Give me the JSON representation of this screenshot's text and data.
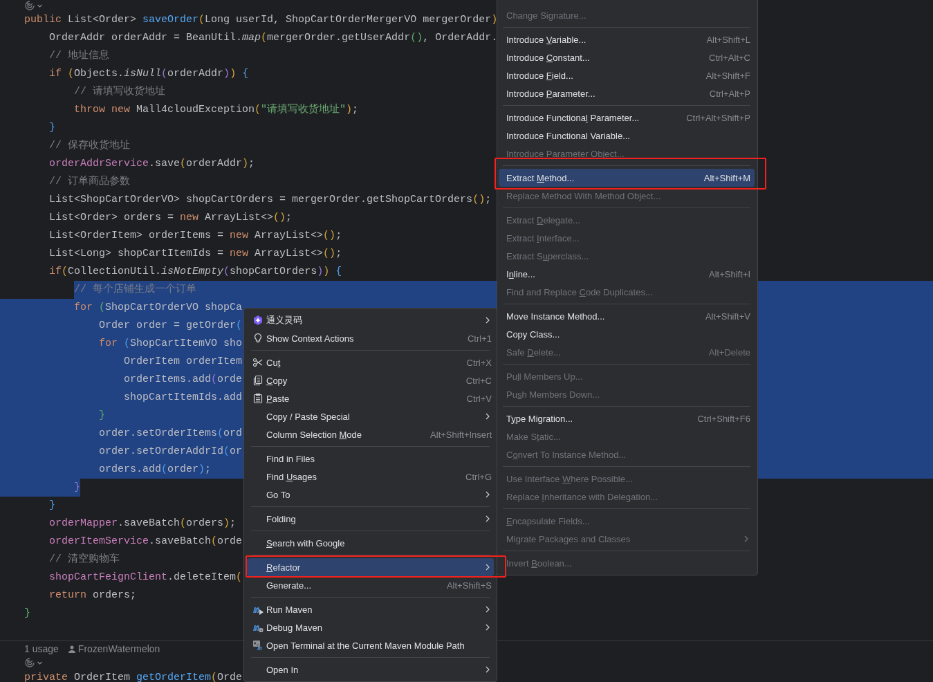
{
  "editor": {
    "lines": [
      {
        "tokens": [
          {
            "kind": "kw",
            "text": "public "
          },
          {
            "kind": "plain",
            "text": "List<Order> "
          },
          {
            "kind": "decl",
            "text": "saveOrder"
          },
          {
            "kind": "bracket_gold",
            "text": "("
          },
          {
            "kind": "plain",
            "text": "Long userId, ShopCartOrderMergerVO mergerOrder"
          },
          {
            "kind": "bracket_gold",
            "text": ")"
          }
        ]
      },
      {
        "tokens": [
          {
            "kind": "plain",
            "text": "    OrderAddr orderAddr = BeanUtil."
          },
          {
            "kind": "static",
            "text": "map"
          },
          {
            "kind": "bracket_gold",
            "text": "("
          },
          {
            "kind": "plain",
            "text": "mergerOrder.getUserAddr"
          },
          {
            "kind": "bracket_green",
            "text": "()"
          },
          {
            "kind": "plain",
            "text": ", OrderAddr."
          }
        ]
      },
      {
        "tokens": [
          {
            "kind": "comment",
            "text": "    // 地址信息"
          }
        ]
      },
      {
        "tokens": [
          {
            "kind": "kw",
            "text": "    if "
          },
          {
            "kind": "bracket_gold",
            "text": "("
          },
          {
            "kind": "plain",
            "text": "Objects."
          },
          {
            "kind": "static",
            "text": "isNull"
          },
          {
            "kind": "bracket_purple",
            "text": "("
          },
          {
            "kind": "plain",
            "text": "orderAddr"
          },
          {
            "kind": "bracket_purple",
            "text": ")"
          },
          {
            "kind": "bracket_gold",
            "text": ")"
          },
          {
            "kind": "bracket_blue",
            "text": " {"
          }
        ]
      },
      {
        "tokens": [
          {
            "kind": "comment",
            "text": "        // 请填写收货地址"
          }
        ]
      },
      {
        "tokens": [
          {
            "kind": "kw",
            "text": "        throw new "
          },
          {
            "kind": "plain",
            "text": "Mall4cloudException"
          },
          {
            "kind": "bracket_gold",
            "text": "("
          },
          {
            "kind": "string",
            "text": "\"请填写收货地址\""
          },
          {
            "kind": "bracket_gold",
            "text": ")"
          },
          {
            "kind": "plain",
            "text": ";"
          }
        ]
      },
      {
        "tokens": [
          {
            "kind": "bracket_blue",
            "text": "    }"
          }
        ]
      },
      {
        "tokens": [
          {
            "kind": "comment",
            "text": "    // 保存收货地址"
          }
        ]
      },
      {
        "tokens": [
          {
            "kind": "field",
            "text": "    orderAddrService"
          },
          {
            "kind": "plain",
            "text": ".save"
          },
          {
            "kind": "bracket_gold",
            "text": "("
          },
          {
            "kind": "plain",
            "text": "orderAddr"
          },
          {
            "kind": "bracket_gold",
            "text": ")"
          },
          {
            "kind": "plain",
            "text": ";"
          }
        ]
      },
      {
        "tokens": [
          {
            "kind": "comment",
            "text": "    // 订单商品参数"
          }
        ]
      },
      {
        "tokens": [
          {
            "kind": "plain",
            "text": "    List<ShopCartOrderVO> shopCartOrders = mergerOrder.getShopCartOrders"
          },
          {
            "kind": "bracket_gold",
            "text": "()"
          },
          {
            "kind": "plain",
            "text": ";"
          }
        ]
      },
      {
        "tokens": [
          {
            "kind": "plain",
            "text": "    List<Order> orders = "
          },
          {
            "kind": "kw",
            "text": "new "
          },
          {
            "kind": "plain",
            "text": "ArrayList<>"
          },
          {
            "kind": "bracket_gold",
            "text": "()"
          },
          {
            "kind": "plain",
            "text": ";"
          }
        ]
      },
      {
        "tokens": [
          {
            "kind": "plain",
            "text": "    List<OrderItem> orderItems = "
          },
          {
            "kind": "kw",
            "text": "new "
          },
          {
            "kind": "plain",
            "text": "ArrayList<>"
          },
          {
            "kind": "bracket_gold",
            "text": "()"
          },
          {
            "kind": "plain",
            "text": ";"
          }
        ]
      },
      {
        "tokens": [
          {
            "kind": "plain",
            "text": "    List<Long> shopCartItemIds = "
          },
          {
            "kind": "kw",
            "text": "new "
          },
          {
            "kind": "plain",
            "text": "ArrayList<>"
          },
          {
            "kind": "bracket_gold",
            "text": "()"
          },
          {
            "kind": "plain",
            "text": ";"
          }
        ]
      },
      {
        "tokens": [
          {
            "kind": "kw",
            "text": "    if"
          },
          {
            "kind": "bracket_gold",
            "text": "("
          },
          {
            "kind": "plain",
            "text": "CollectionUtil."
          },
          {
            "kind": "static",
            "text": "isNotEmpty"
          },
          {
            "kind": "bracket_purple",
            "text": "("
          },
          {
            "kind": "plain",
            "text": "shopCartOrders"
          },
          {
            "kind": "bracket_purple",
            "text": ")"
          },
          {
            "kind": "bracket_gold",
            "text": ")"
          },
          {
            "kind": "bracket_blue",
            "text": " {"
          }
        ]
      },
      {
        "selected": true,
        "selection_starts_here": true,
        "tokens": [
          {
            "kind": "comment",
            "text": "        // 每个店铺生成一个订单"
          }
        ]
      },
      {
        "selected": true,
        "tokens": [
          {
            "kind": "kw",
            "text": "        for "
          },
          {
            "kind": "bracket_green",
            "text": "("
          },
          {
            "kind": "plain",
            "text": "ShopCartOrderVO shopCa"
          }
        ]
      },
      {
        "selected": true,
        "tokens": [
          {
            "kind": "plain",
            "text": "            Order order = getOrder"
          },
          {
            "kind": "bracket_blue",
            "text": "("
          }
        ]
      },
      {
        "selected": true,
        "tokens": [
          {
            "kind": "kw",
            "text": "            for "
          },
          {
            "kind": "bracket_blue",
            "text": "("
          },
          {
            "kind": "plain",
            "text": "ShopCartItemVO sho"
          }
        ]
      },
      {
        "selected": true,
        "tokens": [
          {
            "kind": "plain",
            "text": "                OrderItem orderItem"
          }
        ]
      },
      {
        "selected": true,
        "tokens": [
          {
            "kind": "plain",
            "text": "                orderItems.add"
          },
          {
            "kind": "bracket_purple",
            "text": "("
          },
          {
            "kind": "plain",
            "text": "orde"
          }
        ]
      },
      {
        "selected": true,
        "tokens": [
          {
            "kind": "plain",
            "text": "                shopCartItemIds.add"
          }
        ]
      },
      {
        "selected": true,
        "tokens": [
          {
            "kind": "bracket_green",
            "text": "            }"
          }
        ]
      },
      {
        "selected": true,
        "tokens": [
          {
            "kind": "plain",
            "text": "            order.setOrderItems"
          },
          {
            "kind": "bracket_blue",
            "text": "("
          },
          {
            "kind": "plain",
            "text": "ord"
          }
        ]
      },
      {
        "selected": true,
        "tokens": [
          {
            "kind": "plain",
            "text": "            order.setOrderAddrId"
          },
          {
            "kind": "bracket_blue",
            "text": "("
          },
          {
            "kind": "plain",
            "text": "or"
          }
        ]
      },
      {
        "selected": true,
        "tokens": [
          {
            "kind": "plain",
            "text": "            orders.add"
          },
          {
            "kind": "bracket_blue",
            "text": "("
          },
          {
            "kind": "plain",
            "text": "order"
          },
          {
            "kind": "bracket_blue",
            "text": ")"
          },
          {
            "kind": "plain",
            "text": ";"
          }
        ]
      },
      {
        "selected": true,
        "selection_ends_here": true,
        "tokens": [
          {
            "kind": "bracket_purple",
            "text": "        }"
          }
        ]
      },
      {
        "tokens": [
          {
            "kind": "bracket_blue",
            "text": "    }"
          }
        ]
      },
      {
        "tokens": [
          {
            "kind": "field",
            "text": "    orderMapper"
          },
          {
            "kind": "plain",
            "text": ".saveBatch"
          },
          {
            "kind": "bracket_gold",
            "text": "("
          },
          {
            "kind": "plain",
            "text": "orders"
          },
          {
            "kind": "bracket_gold",
            "text": ")"
          },
          {
            "kind": "plain",
            "text": ";"
          }
        ]
      },
      {
        "tokens": [
          {
            "kind": "field",
            "text": "    orderItemService"
          },
          {
            "kind": "plain",
            "text": ".saveBatch"
          },
          {
            "kind": "bracket_gold",
            "text": "("
          },
          {
            "kind": "plain",
            "text": "orde"
          }
        ]
      },
      {
        "tokens": [
          {
            "kind": "comment",
            "text": "    // 清空购物车"
          }
        ]
      },
      {
        "tokens": [
          {
            "kind": "field",
            "text": "    shopCartFeignClient"
          },
          {
            "kind": "plain",
            "text": ".deleteItem"
          },
          {
            "kind": "bracket_gold",
            "text": "("
          }
        ]
      },
      {
        "tokens": [
          {
            "kind": "kw",
            "text": "    return "
          },
          {
            "kind": "plain",
            "text": "orders;"
          }
        ]
      },
      {
        "tokens": [
          {
            "kind": "bracket_green",
            "text": "}"
          }
        ]
      }
    ],
    "inlay": {
      "usages": "1 usage",
      "author": "FrozenWatermelon"
    },
    "next_lines": [
      {
        "tokens": [
          {
            "kind": "kw",
            "text": "private "
          },
          {
            "kind": "plain",
            "text": "OrderItem "
          },
          {
            "kind": "decl",
            "text": "getOrderItem"
          },
          {
            "kind": "bracket_gold",
            "text": "("
          },
          {
            "kind": "plain",
            "text": "Orde"
          }
        ]
      }
    ]
  },
  "context_menu": {
    "items": [
      {
        "kind": "item",
        "label": "通义灵码",
        "submenu": true,
        "selected": false
      },
      {
        "kind": "item",
        "label": "Show Context Actions",
        "shortcut": "Ctrl+1",
        "selected": false
      },
      {
        "kind": "separator"
      },
      {
        "kind": "item",
        "label": {
          "before": "Cu",
          "key": "t"
        },
        "shortcut": "Ctrl+X",
        "selected": false
      },
      {
        "kind": "item",
        "label": {
          "key": "C",
          "after": "opy"
        },
        "shortcut": "Ctrl+C",
        "selected": false
      },
      {
        "kind": "item",
        "label": {
          "key": "P",
          "after": "aste"
        },
        "shortcut": "Ctrl+V",
        "selected": false
      },
      {
        "kind": "item",
        "label": "Copy / Paste Special",
        "submenu": true,
        "selected": false
      },
      {
        "kind": "item",
        "label": [
          "Column Selection ",
          "M",
          "ode"
        ],
        "shortcut": "Alt+Shift+Insert",
        "selected": false
      },
      {
        "kind": "separator"
      },
      {
        "kind": "item",
        "label": "Find in Files",
        "selected": false
      },
      {
        "kind": "item",
        "label": [
          "Find ",
          "U",
          "sages"
        ],
        "shortcut": "Ctrl+G",
        "selected": false
      },
      {
        "kind": "item",
        "label": "Go To",
        "submenu": true,
        "selected": false
      },
      {
        "kind": "separator"
      },
      {
        "kind": "item",
        "label": "Folding",
        "submenu": true,
        "selected": false
      },
      {
        "kind": "separator"
      },
      {
        "kind": "item",
        "label": {
          "key": "S",
          "after": "earch with Google"
        },
        "selected": false
      },
      {
        "kind": "separator"
      },
      {
        "kind": "item",
        "label": {
          "key": "R",
          "after": "efactor"
        },
        "submenu": true,
        "selected": true,
        "annotated": true
      },
      {
        "kind": "item",
        "label": "Generate...",
        "shortcut": "Alt+Shift+S",
        "selected": false
      },
      {
        "kind": "separator"
      },
      {
        "kind": "item",
        "label": "Run Maven",
        "submenu": true,
        "selected": false
      },
      {
        "kind": "item",
        "label": "Debug Maven",
        "submenu": true,
        "selected": false
      },
      {
        "kind": "item",
        "label": "Open Terminal at the Current Maven Module Path",
        "selected": false
      },
      {
        "kind": "separator"
      },
      {
        "kind": "item",
        "label": "Open In",
        "submenu": true,
        "selected": false
      }
    ]
  },
  "refactor_submenu": {
    "items": [
      {
        "kind": "item",
        "label": "Change Signature...",
        "disabled": true,
        "selected": false
      },
      {
        "kind": "separator"
      },
      {
        "kind": "item",
        "label": [
          "Introduce ",
          "V",
          "ariable..."
        ],
        "shortcut": "Alt+Shift+L",
        "disabled": false,
        "selected": false
      },
      {
        "kind": "item",
        "label": [
          "Introduce ",
          "C",
          "onstant..."
        ],
        "shortcut": "Ctrl+Alt+C",
        "disabled": false,
        "selected": false
      },
      {
        "kind": "item",
        "label": [
          "Introduce ",
          "F",
          "ield..."
        ],
        "shortcut": "Alt+Shift+F",
        "disabled": false,
        "selected": false
      },
      {
        "kind": "item",
        "label": [
          "Introduce ",
          "P",
          "arameter..."
        ],
        "shortcut": "Ctrl+Alt+P",
        "disabled": false,
        "selected": false
      },
      {
        "kind": "separator"
      },
      {
        "kind": "item",
        "label": [
          "Introduce Functiona",
          "l",
          " Parameter..."
        ],
        "shortcut": "Ctrl+Alt+Shift+P",
        "disabled": false,
        "selected": false
      },
      {
        "kind": "item",
        "label": "Introduce Functional Variable...",
        "disabled": false,
        "selected": false
      },
      {
        "kind": "item",
        "label": "Introduce Parameter Object...",
        "disabled": true,
        "selected": false
      },
      {
        "kind": "separator"
      },
      {
        "kind": "item",
        "label": [
          "Extract ",
          "M",
          "ethod..."
        ],
        "shortcut": "Alt+Shift+M",
        "disabled": false,
        "selected": true,
        "annotated": true
      },
      {
        "kind": "item",
        "label": "Replace Method With Method Object...",
        "disabled": true,
        "selected": false
      },
      {
        "kind": "separator"
      },
      {
        "kind": "item",
        "label": [
          "Extract ",
          "D",
          "elegate..."
        ],
        "disabled": true,
        "selected": false
      },
      {
        "kind": "item",
        "label": [
          "Extract ",
          "I",
          "nterface..."
        ],
        "disabled": true,
        "selected": false
      },
      {
        "kind": "item",
        "label": [
          "Extract S",
          "u",
          "perclass..."
        ],
        "disabled": true,
        "selected": false
      },
      {
        "kind": "item",
        "label": [
          "I",
          "n",
          "line..."
        ],
        "shortcut": "Alt+Shift+I",
        "disabled": false,
        "selected": false
      },
      {
        "kind": "item",
        "label": [
          "Find and Replace ",
          "C",
          "ode Duplicates..."
        ],
        "disabled": true,
        "selected": false
      },
      {
        "kind": "separator"
      },
      {
        "kind": "item",
        "label": "Move Instance Method...",
        "shortcut": "Alt+Shift+V",
        "disabled": false,
        "selected": false
      },
      {
        "kind": "item",
        "label": "Copy Class...",
        "disabled": false,
        "selected": false
      },
      {
        "kind": "item",
        "label": [
          "Safe ",
          "D",
          "elete..."
        ],
        "shortcut": "Alt+Delete",
        "disabled": true,
        "selected": false
      },
      {
        "kind": "separator"
      },
      {
        "kind": "item",
        "label": [
          "Pu",
          "l",
          "l Members Up..."
        ],
        "disabled": true,
        "selected": false
      },
      {
        "kind": "item",
        "label": [
          "Pu",
          "s",
          "h Members Down..."
        ],
        "disabled": true,
        "selected": false
      },
      {
        "kind": "separator"
      },
      {
        "kind": "item",
        "label": [
          "T",
          "y",
          "pe Migration..."
        ],
        "shortcut": "Ctrl+Shift+F6",
        "disabled": false,
        "selected": false
      },
      {
        "kind": "item",
        "label": [
          "Make S",
          "t",
          "atic..."
        ],
        "disabled": true,
        "selected": false
      },
      {
        "kind": "item",
        "label": [
          "C",
          "o",
          "nvert To Instance Method..."
        ],
        "disabled": true,
        "selected": false
      },
      {
        "kind": "separator"
      },
      {
        "kind": "item",
        "label": [
          "Use Interface ",
          "W",
          "here Possible..."
        ],
        "disabled": true,
        "selected": false
      },
      {
        "kind": "item",
        "label": [
          "Replace ",
          "I",
          "nheritance with Delegation..."
        ],
        "disabled": true,
        "selected": false
      },
      {
        "kind": "separator"
      },
      {
        "kind": "item",
        "label": {
          "key": "E",
          "after": "ncapsulate Fields..."
        },
        "disabled": true,
        "selected": false
      },
      {
        "kind": "item",
        "label": "Migrate Packages and Classes",
        "submenu": true,
        "disabled": true,
        "selected": false
      },
      {
        "kind": "separator"
      },
      {
        "kind": "item",
        "label": [
          "Invert ",
          "B",
          "oolean..."
        ],
        "disabled": true,
        "selected": false
      }
    ]
  }
}
